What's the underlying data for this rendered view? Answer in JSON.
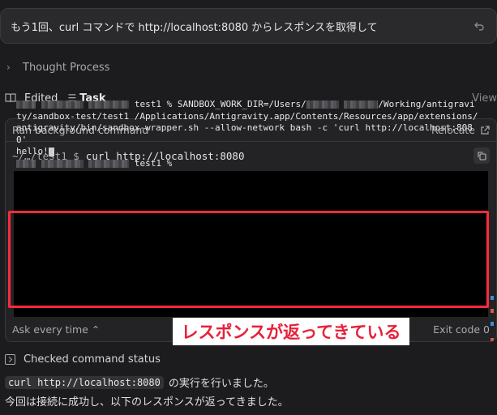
{
  "prompt": {
    "text": "もう1回、curl コマンドで http://localhost:8080 からレスポンスを取得して"
  },
  "thought": {
    "label": "Thought Process"
  },
  "edited": {
    "label": "Edited",
    "task_label": "Task",
    "view_label": "View"
  },
  "command_card": {
    "header_label": "Ran background command",
    "relocate_label": "Relocate",
    "prompt_path": "~/…/test1 $",
    "command": "curl http://localhost:8080",
    "terminal": {
      "line1_suffix": "test1 % SANDBOX_WORK_DIR=/Users/",
      "line1_path_end": "/Working/antigravity/sandbox-test/test1 /Applications/Antigravity.app/Contents/Resources/app/extensions/antigravity/bin/sandbox-wrapper.sh --allow-network bash -c 'curl http://localhost:8080'",
      "output": "hello!",
      "next_prompt": "test1 %"
    },
    "footer_left": "Ask every time",
    "footer_right": "Exit code 0"
  },
  "annotation": {
    "text": "レスポンスが返ってきている",
    "color": "#e8203a",
    "border_color": "#ff2a3d"
  },
  "checked": {
    "label": "Checked command status"
  },
  "response": {
    "code": "curl http://localhost:8080",
    "line1_rest": "の実行を行いました。",
    "line2": "今回は接続に成功し、以下のレスポンスが返ってきました。"
  }
}
